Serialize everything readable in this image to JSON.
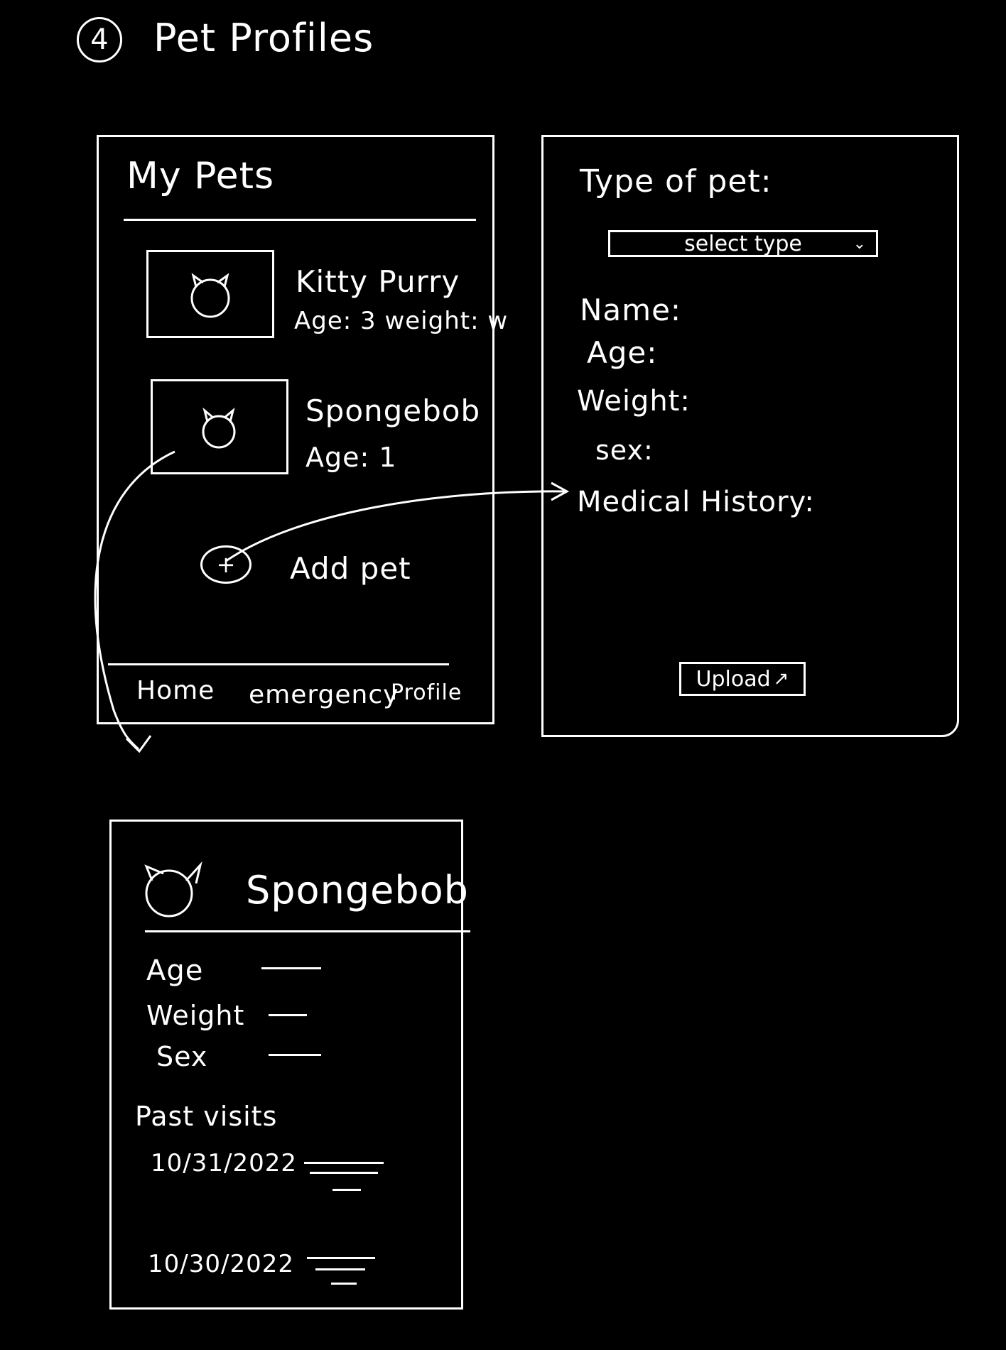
{
  "page": {
    "step_number": "4",
    "title": "Pet Profiles"
  },
  "my_pets_screen": {
    "header": "My Pets",
    "pets": [
      {
        "name": "Kitty Purry",
        "details": "Age: 3  weight: w"
      },
      {
        "name": "Spongebob",
        "details": "Age: 1"
      }
    ],
    "add_pet_label": "Add pet",
    "add_pet_icon": "plus-icon",
    "nav": {
      "home": "Home",
      "emergency": "emergency",
      "profile": "Profile"
    }
  },
  "add_pet_form": {
    "type_label": "Type of pet:",
    "type_select": "select type",
    "fields": {
      "name": "Name:",
      "age": "Age:",
      "weight": "Weight:",
      "sex": "sex:",
      "medical_history": "Medical History:"
    },
    "upload_label": "Upload"
  },
  "pet_detail_screen": {
    "name": "Spongebob",
    "fields": {
      "age": "Age",
      "weight": "Weight",
      "sex": "Sex"
    },
    "past_visits_label": "Past visits",
    "visits": [
      {
        "date": "10/31/2022"
      },
      {
        "date": "10/30/2022"
      }
    ]
  },
  "icons": {
    "pet_avatar": "cat-face-icon",
    "dropdown": "chevron-down-icon",
    "upload": "arrow-up-icon"
  },
  "colors": {
    "background": "#000000",
    "ink": "#ffffff"
  }
}
